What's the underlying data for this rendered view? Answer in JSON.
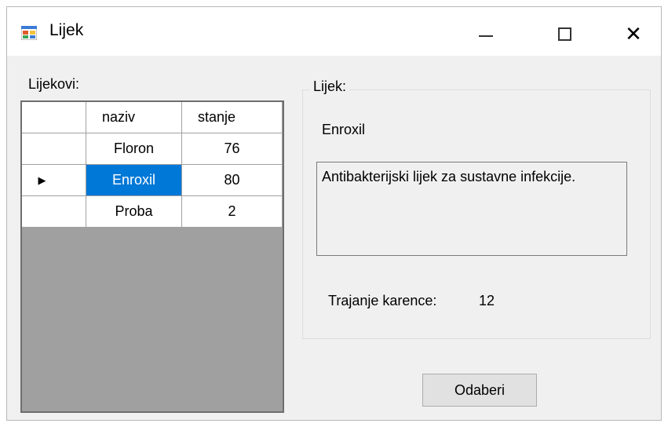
{
  "window": {
    "title": "Lijek",
    "icon": "windows-form-icon"
  },
  "left": {
    "label": "Lijekovi:",
    "grid": {
      "columns": [
        "naziv",
        "stanje"
      ],
      "rows": [
        {
          "naziv": "Floron",
          "stanje": "76",
          "current": false
        },
        {
          "naziv": "Enroxil",
          "stanje": "80",
          "current": true
        },
        {
          "naziv": "Proba",
          "stanje": "2",
          "current": false
        }
      ],
      "current_row_indicator": "▶"
    }
  },
  "detail": {
    "group_title": "Lijek:",
    "name": "Enroxil",
    "description": "Antibakterijski lijek za sustavne infekcije.",
    "karenca_label": "Trajanje karence:",
    "karenca_value": "12"
  },
  "buttons": {
    "odaberi": "Odaberi",
    "close_symbol": "✕"
  },
  "colors": {
    "selection": "#0078d7",
    "grid_background": "#a0a0a0",
    "form_background": "#f0f0f0"
  }
}
